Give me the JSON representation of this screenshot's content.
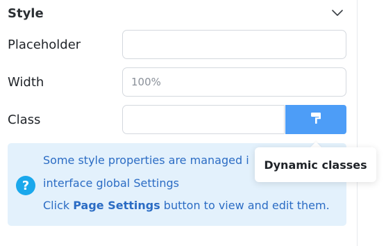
{
  "style_section": {
    "title": "Style",
    "chevron_icon": "chevron-down-icon"
  },
  "fields": {
    "placeholder": {
      "label": "Placeholder",
      "value": "",
      "placeholder": ""
    },
    "width": {
      "label": "Width",
      "value": "",
      "placeholder": "100%"
    },
    "class": {
      "label": "Class",
      "value": "",
      "placeholder": "",
      "button_icon": "paint-roller-icon"
    }
  },
  "info": {
    "help_icon": "question-icon",
    "help_glyph": "?",
    "line1": "Some style properties are managed i",
    "line2": "interface global Settings",
    "line3_prefix": "Click ",
    "line3_bold": "Page Settings",
    "line3_suffix": " button to view and edit them."
  },
  "tooltip": {
    "text": "Dynamic classes"
  },
  "colors": {
    "accent": "#4d9df7",
    "info_bg": "#e3f1fc",
    "info_text": "#2b6cc4",
    "help_icon_bg": "#1aa8ec"
  }
}
